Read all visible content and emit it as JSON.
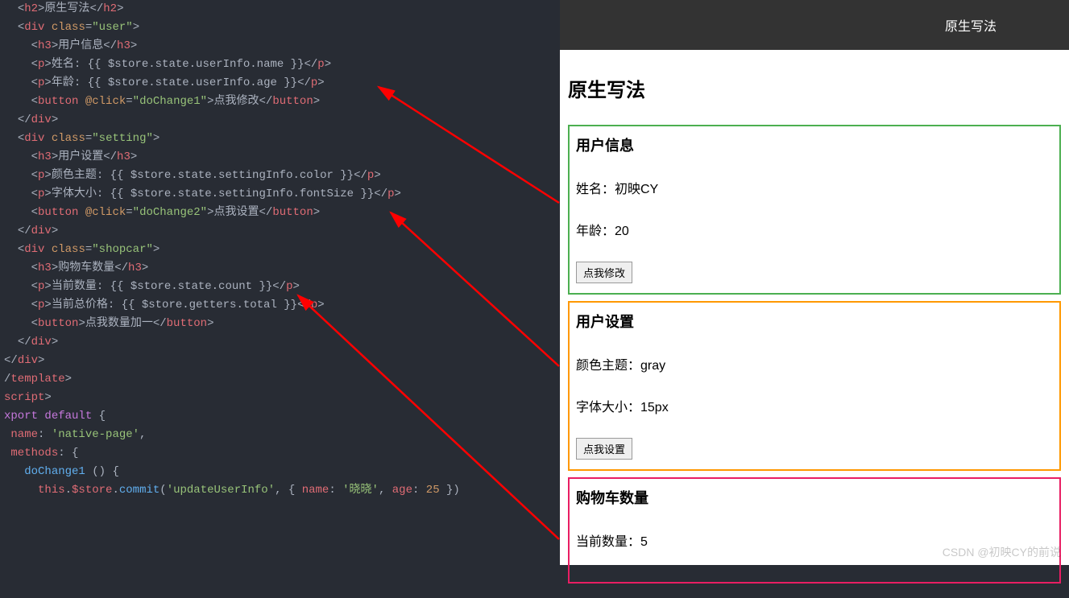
{
  "code": {
    "lines": [
      [
        [
          "  ",
          "punct"
        ],
        [
          "<",
          "punct"
        ],
        [
          "h2",
          "tag"
        ],
        [
          ">",
          "punct"
        ],
        [
          "原生写法",
          "text"
        ],
        [
          "</",
          "punct"
        ],
        [
          "h2",
          "tag"
        ],
        [
          ">",
          "punct"
        ]
      ],
      [
        [
          "  ",
          "punct"
        ],
        [
          "<",
          "punct"
        ],
        [
          "div",
          "tag"
        ],
        [
          " ",
          "punct"
        ],
        [
          "class",
          "attr"
        ],
        [
          "=",
          "punct"
        ],
        [
          "\"user\"",
          "str"
        ],
        [
          ">",
          "punct"
        ]
      ],
      [
        [
          "    ",
          "punct"
        ],
        [
          "<",
          "punct"
        ],
        [
          "h3",
          "tag"
        ],
        [
          ">",
          "punct"
        ],
        [
          "用户信息",
          "text"
        ],
        [
          "</",
          "punct"
        ],
        [
          "h3",
          "tag"
        ],
        [
          ">",
          "punct"
        ]
      ],
      [
        [
          "    ",
          "punct"
        ],
        [
          "<",
          "punct"
        ],
        [
          "p",
          "tag"
        ],
        [
          ">",
          "punct"
        ],
        [
          "姓名: {{ $store.state.userInfo.name }}",
          "text"
        ],
        [
          "</",
          "punct"
        ],
        [
          "p",
          "tag"
        ],
        [
          ">",
          "punct"
        ]
      ],
      [
        [
          "    ",
          "punct"
        ],
        [
          "<",
          "punct"
        ],
        [
          "p",
          "tag"
        ],
        [
          ">",
          "punct"
        ],
        [
          "年龄: {{ $store.state.userInfo.age }}",
          "text"
        ],
        [
          "</",
          "punct"
        ],
        [
          "p",
          "tag"
        ],
        [
          ">",
          "punct"
        ]
      ],
      [
        [
          "    ",
          "punct"
        ],
        [
          "<",
          "punct"
        ],
        [
          "button",
          "tag"
        ],
        [
          " ",
          "punct"
        ],
        [
          "@click",
          "attr"
        ],
        [
          "=",
          "punct"
        ],
        [
          "\"doChange1\"",
          "str"
        ],
        [
          ">",
          "punct"
        ],
        [
          "点我修改",
          "text"
        ],
        [
          "</",
          "punct"
        ],
        [
          "button",
          "tag"
        ],
        [
          ">",
          "punct"
        ]
      ],
      [
        [
          "  ",
          "punct"
        ],
        [
          "</",
          "punct"
        ],
        [
          "div",
          "tag"
        ],
        [
          ">",
          "punct"
        ]
      ],
      [
        [
          "  ",
          "punct"
        ],
        [
          "<",
          "punct"
        ],
        [
          "div",
          "tag"
        ],
        [
          " ",
          "punct"
        ],
        [
          "class",
          "attr"
        ],
        [
          "=",
          "punct"
        ],
        [
          "\"setting\"",
          "str"
        ],
        [
          ">",
          "punct"
        ]
      ],
      [
        [
          "    ",
          "punct"
        ],
        [
          "<",
          "punct"
        ],
        [
          "h3",
          "tag"
        ],
        [
          ">",
          "punct"
        ],
        [
          "用户设置",
          "text"
        ],
        [
          "</",
          "punct"
        ],
        [
          "h3",
          "tag"
        ],
        [
          ">",
          "punct"
        ]
      ],
      [
        [
          "    ",
          "punct"
        ],
        [
          "<",
          "punct"
        ],
        [
          "p",
          "tag"
        ],
        [
          ">",
          "punct"
        ],
        [
          "颜色主题: {{ $store.state.settingInfo.color }}",
          "text"
        ],
        [
          "</",
          "punct"
        ],
        [
          "p",
          "tag"
        ],
        [
          ">",
          "punct"
        ]
      ],
      [
        [
          "    ",
          "punct"
        ],
        [
          "<",
          "punct"
        ],
        [
          "p",
          "tag"
        ],
        [
          ">",
          "punct"
        ],
        [
          "字体大小: {{ $store.state.settingInfo.fontSize }}",
          "text"
        ],
        [
          "</",
          "punct"
        ],
        [
          "p",
          "tag"
        ],
        [
          ">",
          "punct"
        ]
      ],
      [
        [
          "    ",
          "punct"
        ],
        [
          "<",
          "punct"
        ],
        [
          "button",
          "tag"
        ],
        [
          " ",
          "punct"
        ],
        [
          "@click",
          "attr"
        ],
        [
          "=",
          "punct"
        ],
        [
          "\"doChange2\"",
          "str"
        ],
        [
          ">",
          "punct"
        ],
        [
          "点我设置",
          "text"
        ],
        [
          "</",
          "punct"
        ],
        [
          "button",
          "tag"
        ],
        [
          ">",
          "punct"
        ]
      ],
      [
        [
          "  ",
          "punct"
        ],
        [
          "</",
          "punct"
        ],
        [
          "div",
          "tag"
        ],
        [
          ">",
          "punct"
        ]
      ],
      [
        [
          "  ",
          "punct"
        ],
        [
          "<",
          "punct"
        ],
        [
          "div",
          "tag"
        ],
        [
          " ",
          "punct"
        ],
        [
          "class",
          "attr"
        ],
        [
          "=",
          "punct"
        ],
        [
          "\"shopcar\"",
          "str"
        ],
        [
          ">",
          "punct"
        ]
      ],
      [
        [
          "    ",
          "punct"
        ],
        [
          "<",
          "punct"
        ],
        [
          "h3",
          "tag"
        ],
        [
          ">",
          "punct"
        ],
        [
          "购物车数量",
          "text"
        ],
        [
          "</",
          "punct"
        ],
        [
          "h3",
          "tag"
        ],
        [
          ">",
          "punct"
        ]
      ],
      [
        [
          "    ",
          "punct"
        ],
        [
          "<",
          "punct"
        ],
        [
          "p",
          "tag"
        ],
        [
          ">",
          "punct"
        ],
        [
          "当前数量: {{ $store.state.count }}",
          "text"
        ],
        [
          "</",
          "punct"
        ],
        [
          "p",
          "tag"
        ],
        [
          ">",
          "punct"
        ]
      ],
      [
        [
          "    ",
          "punct"
        ],
        [
          "<",
          "punct"
        ],
        [
          "p",
          "tag"
        ],
        [
          ">",
          "punct"
        ],
        [
          "当前总价格: {{ $store.getters.total }}",
          "text"
        ],
        [
          "</",
          "punct"
        ],
        [
          "p",
          "tag"
        ],
        [
          ">",
          "punct"
        ]
      ],
      [
        [
          "",
          "punct"
        ]
      ],
      [
        [
          "    ",
          "punct"
        ],
        [
          "<",
          "punct"
        ],
        [
          "button",
          "tag"
        ],
        [
          ">",
          "punct"
        ],
        [
          "点我数量加一",
          "text"
        ],
        [
          "</",
          "punct"
        ],
        [
          "button",
          "tag"
        ],
        [
          ">",
          "punct"
        ]
      ],
      [
        [
          "  ",
          "punct"
        ],
        [
          "</",
          "punct"
        ],
        [
          "div",
          "tag"
        ],
        [
          ">",
          "punct"
        ]
      ],
      [
        [
          "</",
          "punct"
        ],
        [
          "div",
          "tag"
        ],
        [
          ">",
          "punct"
        ]
      ],
      [
        [
          "/",
          "punct"
        ],
        [
          "template",
          "tag"
        ],
        [
          ">",
          "punct"
        ]
      ],
      [
        [
          "",
          "punct"
        ]
      ],
      [
        [
          "script",
          "tag"
        ],
        [
          ">",
          "punct"
        ]
      ],
      [
        [
          "xport",
          "kw"
        ],
        [
          " ",
          "punct"
        ],
        [
          "default",
          "kw"
        ],
        [
          " {",
          "punct"
        ]
      ],
      [
        [
          " ",
          "punct"
        ],
        [
          "name",
          "prop"
        ],
        [
          ": ",
          "punct"
        ],
        [
          "'native-page'",
          "str"
        ],
        [
          ",",
          "punct"
        ]
      ],
      [
        [
          " ",
          "punct"
        ],
        [
          "methods",
          "prop"
        ],
        [
          ": {",
          "punct"
        ]
      ],
      [
        [
          "   ",
          "punct"
        ],
        [
          "doChange1",
          "fn"
        ],
        [
          " () {",
          "punct"
        ]
      ],
      [
        [
          "     ",
          "punct"
        ],
        [
          "this",
          "this"
        ],
        [
          ".",
          "punct"
        ],
        [
          "$store",
          "prop"
        ],
        [
          ".",
          "punct"
        ],
        [
          "commit",
          "fn"
        ],
        [
          "(",
          "punct"
        ],
        [
          "'updateUserInfo'",
          "str"
        ],
        [
          ", { ",
          "punct"
        ],
        [
          "name",
          "prop"
        ],
        [
          ": ",
          "punct"
        ],
        [
          "'晓晓'",
          "str"
        ],
        [
          ", ",
          "punct"
        ],
        [
          "age",
          "prop"
        ],
        [
          ": ",
          "punct"
        ],
        [
          "25",
          "num"
        ],
        [
          " })",
          "punct"
        ]
      ]
    ]
  },
  "preview": {
    "headerLink": "原生写法",
    "title": "原生写法",
    "user": {
      "heading": "用户信息",
      "nameLabel": "姓名：初映CY",
      "ageLabel": "年龄：20",
      "button": "点我修改"
    },
    "setting": {
      "heading": "用户设置",
      "colorLabel": "颜色主题：gray",
      "fontLabel": "字体大小：15px",
      "button": "点我设置"
    },
    "shopcar": {
      "heading": "购物车数量",
      "countLabel": "当前数量：5"
    }
  },
  "watermark": "CSDN @初映CY的前说"
}
